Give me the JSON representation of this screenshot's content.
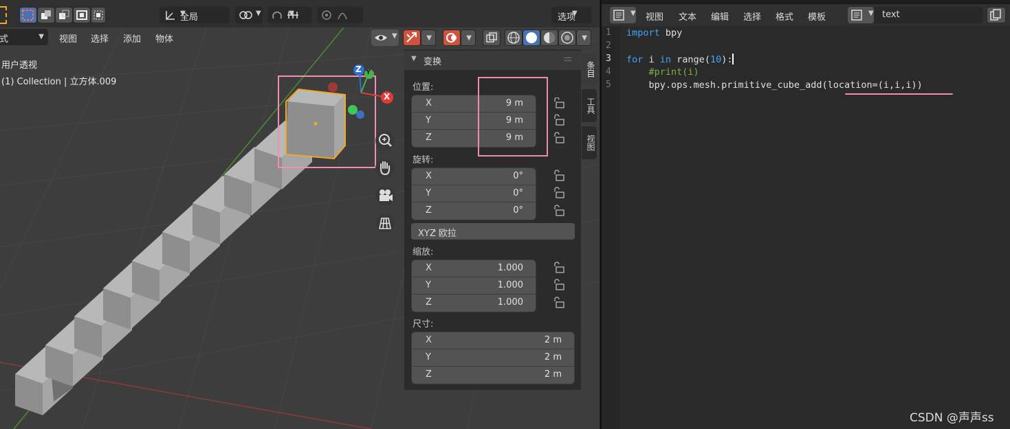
{
  "viewport_header": {
    "mode_label": "模式",
    "menu": [
      "视图",
      "选择",
      "添加",
      "物体"
    ],
    "orientation_label": "全局",
    "options_label": "选项"
  },
  "viewport_overlay": {
    "view_name": "用户透视",
    "collection_info": "(1) Collection | 立方体.009"
  },
  "gizmo": {
    "x": "X",
    "y": "Y",
    "z": "Z"
  },
  "npanel": {
    "title": "变换",
    "location_label": "位置:",
    "location": [
      {
        "axis": "X",
        "value": "9 m"
      },
      {
        "axis": "Y",
        "value": "9 m"
      },
      {
        "axis": "Z",
        "value": "9 m"
      }
    ],
    "rotation_label": "旋转:",
    "rotation": [
      {
        "axis": "X",
        "value": "0°"
      },
      {
        "axis": "Y",
        "value": "0°"
      },
      {
        "axis": "Z",
        "value": "0°"
      }
    ],
    "rotation_mode": "XYZ 欧拉",
    "scale_label": "缩放:",
    "scale": [
      {
        "axis": "X",
        "value": "1.000"
      },
      {
        "axis": "Y",
        "value": "1.000"
      },
      {
        "axis": "Z",
        "value": "1.000"
      }
    ],
    "dimensions_label": "尺寸:",
    "dimensions": [
      {
        "axis": "X",
        "value": "2 m"
      },
      {
        "axis": "Y",
        "value": "2 m"
      },
      {
        "axis": "Z",
        "value": "2 m"
      }
    ],
    "tabs": [
      "条目",
      "工具",
      "视图"
    ]
  },
  "editor": {
    "menu": [
      "视图",
      "文本",
      "编辑",
      "选择",
      "格式",
      "模板"
    ],
    "text_name": "text",
    "line_numbers": [
      "1",
      "2",
      "3",
      "4",
      "5"
    ],
    "code": {
      "l1_kw": "import",
      "l1_rest": " bpy",
      "l3_kw1": "for",
      "l3_a": " i ",
      "l3_kw2": "in",
      "l3_b": " range(",
      "l3_num": "10",
      "l3_c": "):",
      "l4_comment": "    #print(i)",
      "l5_pre": "    bpy.ops.mesh.primitive_cube_add(",
      "l5_hl": "location=(i,i,i))"
    }
  },
  "watermark": "CSDN @声声ss",
  "colors": {
    "highlight_box": "#f48fb1",
    "selection_orange": "#f5a623",
    "keyword": "#42a5f5",
    "comment": "#7cb342"
  }
}
